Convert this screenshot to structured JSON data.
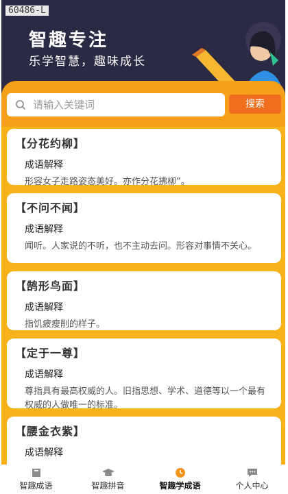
{
  "banner": {
    "id_text": "60486-L",
    "title": "智趣专注",
    "subtitle": "乐学智慧，趣味成长"
  },
  "search": {
    "placeholder": "请输入关键词",
    "button": "搜索"
  },
  "idioms": [
    {
      "title": "【分花约柳】",
      "subtitle": "成语解释",
      "desc": "形容女子走路姿态美好。亦作分花拂柳”。"
    },
    {
      "title": "【不问不闻】",
      "subtitle": "成语解释",
      "desc": "闻听。人家说的不听，也不主动去问。形容对事情不关心。"
    },
    {
      "title": "【鹄形鸟面】",
      "subtitle": "成语解释",
      "desc": "指饥疲瘦削的样子。"
    },
    {
      "title": "【定于一尊】",
      "subtitle": "成语解释",
      "desc": "尊指具有最高权威的人。旧指思想、学术、道德等以一个最有权威的人做唯一的标准。"
    },
    {
      "title": "【腰金衣紫】",
      "subtitle": "成语解释",
      "desc": ""
    }
  ],
  "tabs": [
    {
      "label": "智趣成语",
      "icon": "book-icon",
      "active": false
    },
    {
      "label": "智趣拼音",
      "icon": "graduation-cap-icon",
      "active": false
    },
    {
      "label": "智趣学成语",
      "icon": "clock-icon",
      "active": true
    },
    {
      "label": "个人中心",
      "icon": "chat-bubble-icon",
      "active": false
    }
  ],
  "colors": {
    "accent": "#f06f1e",
    "background": "#f8b21a",
    "banner": "#2b2a44"
  }
}
